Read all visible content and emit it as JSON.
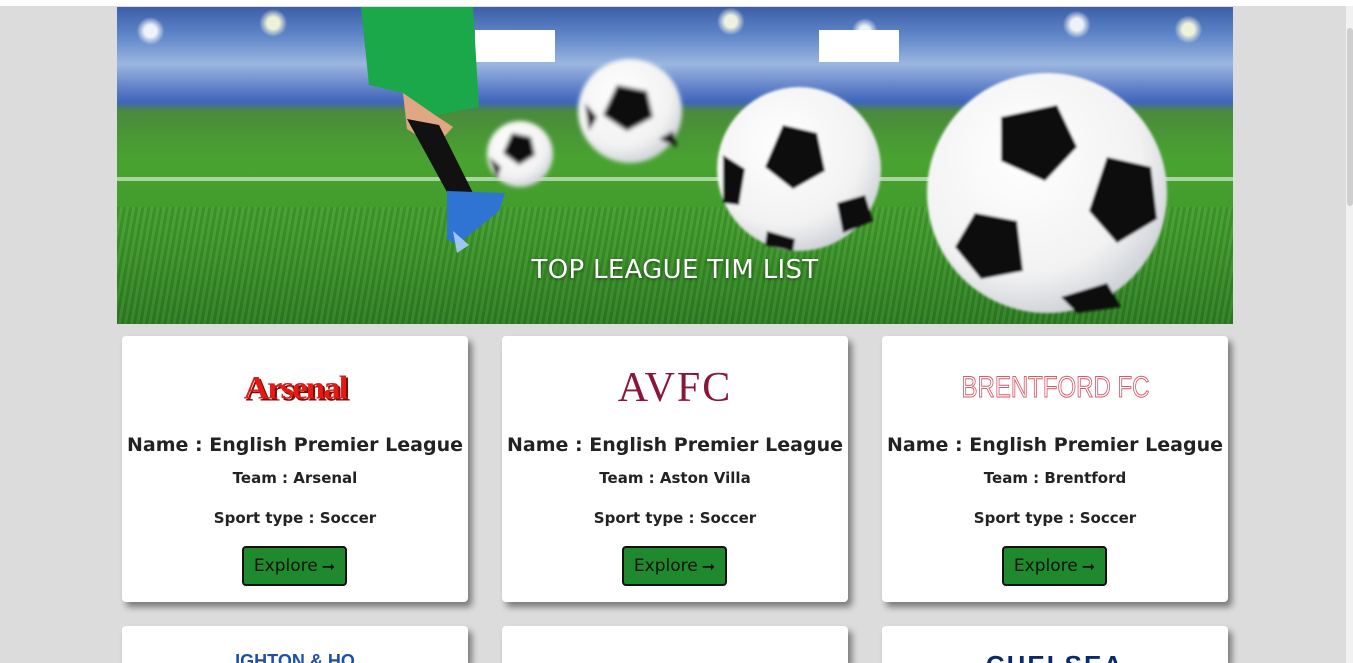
{
  "banner": {
    "title": "TOP LEAGUE TIM LIST",
    "image_alt": "soccer-player-kicking-balls-image"
  },
  "colors": {
    "page_background": "#dcdcdc",
    "button_green": "#1f8a2d",
    "arsenal_red": "#e31b14",
    "avfc_claret": "#8a1538",
    "brentford_red": "#d55a6a",
    "chelsea_blue": "#0a2a6e"
  },
  "cards": [
    {
      "logo_text": "Arsenal",
      "name": "Name : English Premier League",
      "team": "Team : Arsenal",
      "sport": "Sport type : Soccer",
      "button_label": "Explore",
      "button_icon": "arrow-right-icon"
    },
    {
      "logo_text": "AVFC",
      "name": "Name : English Premier League",
      "team": "Team : Aston Villa",
      "sport": "Sport type : Soccer",
      "button_label": "Explore",
      "button_icon": "arrow-right-icon"
    },
    {
      "logo_text": "BRENTFORD FC",
      "name": "Name : English Premier League",
      "team": "Team : Brentford",
      "sport": "Sport type : Soccer",
      "button_label": "Explore",
      "button_icon": "arrow-right-icon"
    }
  ],
  "partial_cards": [
    {
      "logo_text": "IGHTON & HO"
    },
    {
      "logo_text": ""
    },
    {
      "logo_text": "CHELSEA"
    }
  ]
}
